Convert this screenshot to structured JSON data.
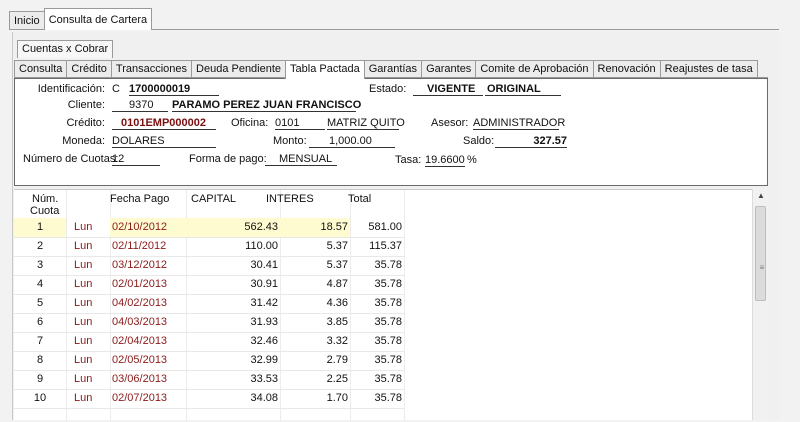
{
  "top_tabs": [
    "Inicio",
    "Consulta de Cartera"
  ],
  "sub_tab": "Cuentas x Cobrar",
  "section_tabs": [
    "Consulta",
    "Crédito",
    "Transacciones",
    "Deuda Pendiente",
    "Tabla Pactada",
    "Garantías",
    "Garantes",
    "Comite de Aprobación",
    "Renovación",
    "Reajustes de tasa"
  ],
  "info": {
    "identificacion_label": "Identificación:",
    "identificacion_tipo": "C",
    "identificacion_num": "1700000019",
    "estado_label": "Estado:",
    "estado_value": "VIGENTE",
    "estado_tipo": "ORIGINAL",
    "cliente_label": "Cliente:",
    "cliente_code": "9370",
    "cliente_name": "PARAMO PEREZ JUAN FRANCISCO",
    "credito_label": "Crédito:",
    "credito_value": "0101EMP000002",
    "oficina_label": "Oficina:",
    "oficina_code": "0101",
    "oficina_name": "MATRIZ QUITO",
    "asesor_label": "Asesor:",
    "asesor_value": "ADMINISTRADOR",
    "moneda_label": "Moneda:",
    "moneda_value": "DOLARES",
    "monto_label": "Monto:",
    "monto_value": "1,000.00",
    "saldo_label": "Saldo:",
    "saldo_value": "327.57",
    "cuotas_label": "Número de Cuotas:",
    "cuotas_value": "12",
    "forma_pago_label": "Forma de pago:",
    "forma_pago_value": "MENSUAL",
    "tasa_label": "Tasa:",
    "tasa_value": "19.6600",
    "tasa_unit": "%"
  },
  "table": {
    "headers": {
      "num": "Núm.",
      "num2": "Cuota",
      "fecha": "Fecha Pago",
      "capital": "CAPITAL",
      "interes": "INTERES",
      "total": "Total"
    },
    "rows": [
      {
        "num": "1",
        "day": "Lun",
        "fecha": "02/10/2012",
        "capital": "562.43",
        "interes": "18.57",
        "total": "581.00"
      },
      {
        "num": "2",
        "day": "Lun",
        "fecha": "02/11/2012",
        "capital": "110.00",
        "interes": "5.37",
        "total": "115.37"
      },
      {
        "num": "3",
        "day": "Lun",
        "fecha": "03/12/2012",
        "capital": "30.41",
        "interes": "5.37",
        "total": "35.78"
      },
      {
        "num": "4",
        "day": "Lun",
        "fecha": "02/01/2013",
        "capital": "30.91",
        "interes": "4.87",
        "total": "35.78"
      },
      {
        "num": "5",
        "day": "Lun",
        "fecha": "04/02/2013",
        "capital": "31.42",
        "interes": "4.36",
        "total": "35.78"
      },
      {
        "num": "6",
        "day": "Lun",
        "fecha": "04/03/2013",
        "capital": "31.93",
        "interes": "3.85",
        "total": "35.78"
      },
      {
        "num": "7",
        "day": "Lun",
        "fecha": "02/04/2013",
        "capital": "32.46",
        "interes": "3.32",
        "total": "35.78"
      },
      {
        "num": "8",
        "day": "Lun",
        "fecha": "02/05/2013",
        "capital": "32.99",
        "interes": "2.79",
        "total": "35.78"
      },
      {
        "num": "9",
        "day": "Lun",
        "fecha": "03/06/2013",
        "capital": "33.53",
        "interes": "2.25",
        "total": "35.78"
      },
      {
        "num": "10",
        "day": "Lun",
        "fecha": "02/07/2013",
        "capital": "34.08",
        "interes": "1.70",
        "total": "35.78"
      }
    ]
  },
  "colors": {
    "selected_row": "#fffbd0",
    "credit_text": "#7a0f0f",
    "border": "#9a9a9a"
  },
  "icons": {
    "scroll_up": "scroll-up-arrow-icon",
    "scroll_grip": "scroll-grip-icon"
  }
}
